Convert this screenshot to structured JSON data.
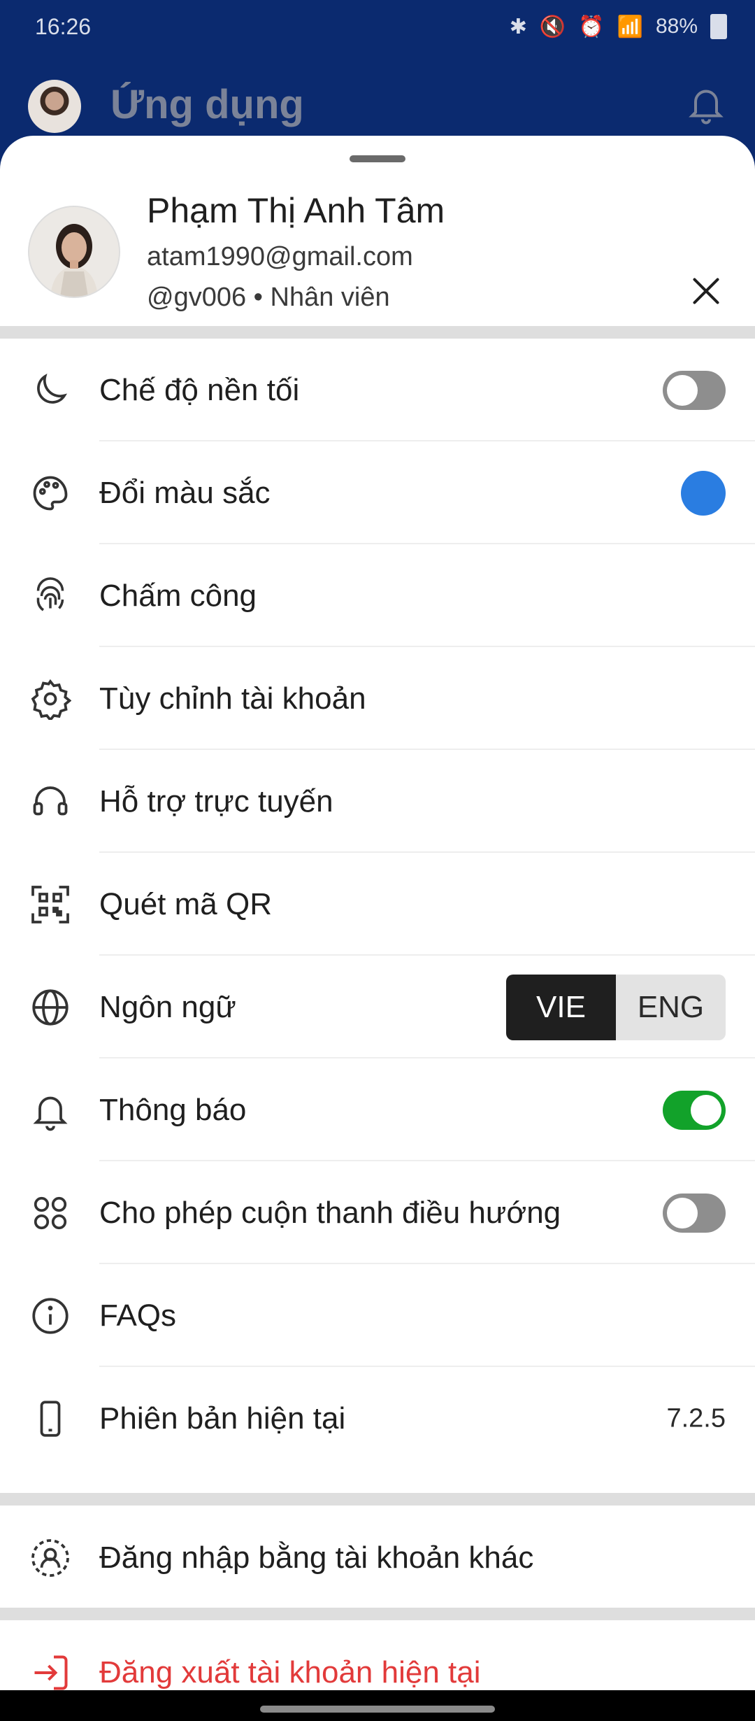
{
  "status_bar": {
    "time": "16:26",
    "battery": "88%"
  },
  "app_bar": {
    "title": "Ứng dụng",
    "icons": [
      "avatar",
      "bell-icon"
    ]
  },
  "profile": {
    "name": "Phạm Thị Anh Tâm",
    "email": "atam1990@gmail.com",
    "handle_role": "@gv006 • Nhân viên"
  },
  "menu": [
    {
      "label": "Chế độ nền tối",
      "icon": "moon-icon",
      "control": "toggle",
      "state": "off"
    },
    {
      "label": "Đổi màu sắc",
      "icon": "palette-icon",
      "control": "color",
      "color": "#2a7de1"
    },
    {
      "label": "Chấm công",
      "icon": "fingerprint-icon"
    },
    {
      "label": "Tùy chỉnh tài khoản",
      "icon": "gear-icon"
    },
    {
      "label": "Hỗ trợ trực tuyến",
      "icon": "headset-icon"
    },
    {
      "label": "Quét mã QR",
      "icon": "qr-code-icon"
    },
    {
      "label": "Ngôn ngữ",
      "icon": "globe-icon",
      "control": "segmented",
      "options": [
        "VIE",
        "ENG"
      ],
      "selected": "VIE"
    },
    {
      "label": "Thông báo",
      "icon": "bell-icon",
      "control": "toggle",
      "state": "on"
    },
    {
      "label": "Cho phép cuộn thanh điều hướng",
      "icon": "grid-dots-icon",
      "control": "toggle",
      "state": "off"
    },
    {
      "label": "FAQs",
      "icon": "info-icon"
    },
    {
      "label": "Phiên bản hiện tại",
      "icon": "phone-icon",
      "value": "7.2.5"
    }
  ],
  "alt_login": {
    "label": "Đăng nhập bằng tài khoản khác",
    "icon": "switch-account-icon"
  },
  "logout": {
    "label": "Đăng xuất tài khoản hiện tại",
    "icon": "logout-icon",
    "color": "#e23a3a"
  },
  "colors": {
    "header_bg": "#0b2a6f",
    "toggle_on": "#12a22a",
    "accent": "#2a7de1"
  }
}
